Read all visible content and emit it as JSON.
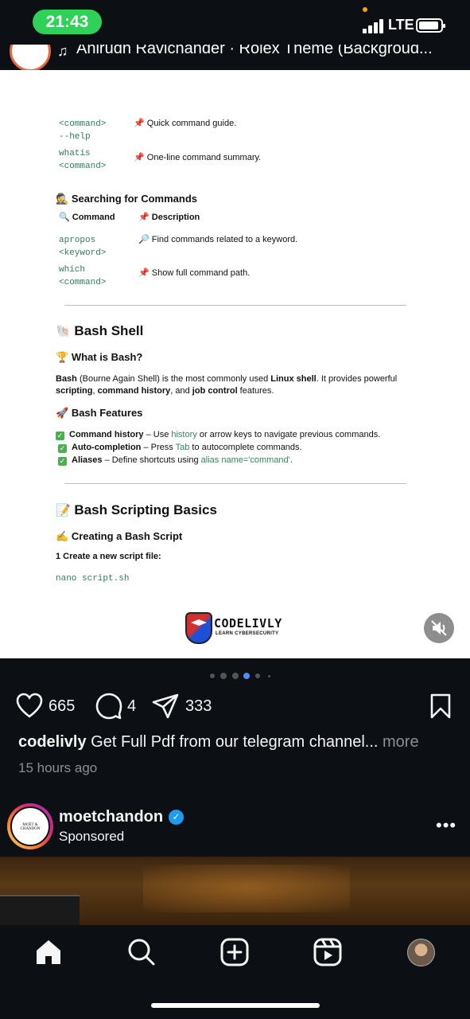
{
  "status_bar": {
    "time": "21:43",
    "network": "LTE",
    "accent_color": "#30d158"
  },
  "music": {
    "track_text": "Anirudh Ravichander · Rolex Theme (Backgroud..."
  },
  "document": {
    "rows_top": [
      {
        "command_line1": "<command>",
        "command_line2": "--help",
        "desc": "Quick command guide."
      },
      {
        "command_line1": "whatis",
        "command_line2": "<command>",
        "desc": "One-line command summary."
      }
    ],
    "search_section": {
      "heading": "Searching for Commands",
      "col_command": "Command",
      "col_description": "Description",
      "rows": [
        {
          "command_line1": "apropos",
          "command_line2": "<keyword>",
          "desc": "Find commands related to a keyword."
        },
        {
          "command_line1": "which",
          "command_line2": "<command>",
          "desc": "Show full command path."
        }
      ]
    },
    "bash_shell": {
      "heading": "Bash Shell",
      "what_heading": "What is Bash?",
      "para_bold1": "Bash",
      "para_text1": " (Bourne Again Shell) is the most commonly used ",
      "para_bold2": "Linux shell",
      "para_text2": ". It provides powerful",
      "para_bold3": "scripting",
      "para_text3": ", ",
      "para_bold4": "command history",
      "para_text4": ", and ",
      "para_bold5": "job control",
      "para_text5": " features.",
      "features_heading": "Bash Features",
      "features": [
        {
          "name": "Command history",
          "sep": " – Use ",
          "green": "history",
          "rest": " or arrow keys to navigate previous commands."
        },
        {
          "name": "Auto-completion",
          "sep": " – Press ",
          "green": "Tab",
          "rest": " to autocomplete commands."
        },
        {
          "name": "Aliases",
          "sep": " – Define shortcuts using ",
          "green": "alias name='command'",
          "rest": "."
        }
      ]
    },
    "scripting": {
      "heading": "Bash Scripting Basics",
      "sub_heading": "Creating a Bash Script",
      "step": "1 Create a new script file:",
      "code": "nano script.sh"
    },
    "logo": {
      "name": "CODELIVLY",
      "tagline": "LEARN CYBERSECURITY"
    }
  },
  "actions": {
    "likes": "665",
    "comments": "4",
    "shares": "333"
  },
  "caption": {
    "username": "codelivly",
    "text": " Get Full Pdf from our telegram channel...",
    "more": " more",
    "time_ago": "15 hours ago"
  },
  "sponsored": {
    "username": "moetchandon",
    "label": "Sponsored",
    "avatar_text": "MOËT & CHANDON",
    "verified_color": "#1d9bf0"
  }
}
